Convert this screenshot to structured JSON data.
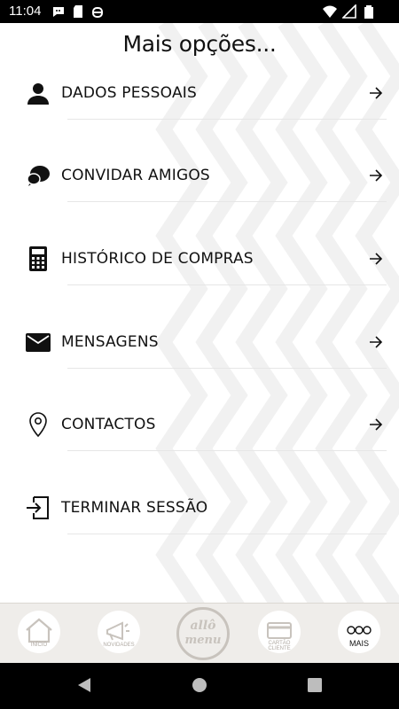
{
  "status_bar": {
    "time": "11:04",
    "left_icons": [
      "chat-bubble-icon",
      "sd-card-icon",
      "android-debug-icon"
    ],
    "right_icons": [
      "wifi-icon",
      "signal-icon",
      "battery-icon"
    ]
  },
  "page": {
    "title": "Mais opções..."
  },
  "menu": [
    {
      "label": "DADOS PESSOAIS",
      "icon": "person-icon",
      "has_arrow": true
    },
    {
      "label": "CONVIDAR AMIGOS",
      "icon": "chat-bubbles-icon",
      "has_arrow": true
    },
    {
      "label": "HISTÓRICO DE COMPRAS",
      "icon": "calculator-icon",
      "has_arrow": true
    },
    {
      "label": "MENSAGENS",
      "icon": "envelope-icon",
      "has_arrow": true
    },
    {
      "label": "CONTACTOS",
      "icon": "location-pin-icon",
      "has_arrow": true
    },
    {
      "label": "TERMINAR SESSÃO",
      "icon": "logout-icon",
      "has_arrow": false
    }
  ],
  "tabbar": {
    "tabs": [
      {
        "label": "INÍCIO",
        "icon": "home-icon",
        "active": false
      },
      {
        "label": "NOVIDADES",
        "icon": "megaphone-icon",
        "active": false
      },
      {
        "label": "allô menu",
        "icon": "logo-icon",
        "active": false
      },
      {
        "label": "CARTÃO CLIENTE",
        "icon": "card-icon",
        "active": false
      },
      {
        "label": "MAIS",
        "icon": "more-icon",
        "active": true
      }
    ]
  },
  "nav": {
    "buttons": [
      "back-icon",
      "home-icon",
      "recents-icon"
    ]
  },
  "colors": {
    "accent_inactive": "#c8c3bd",
    "tabbar_bg": "#efedea",
    "text": "#111111"
  }
}
